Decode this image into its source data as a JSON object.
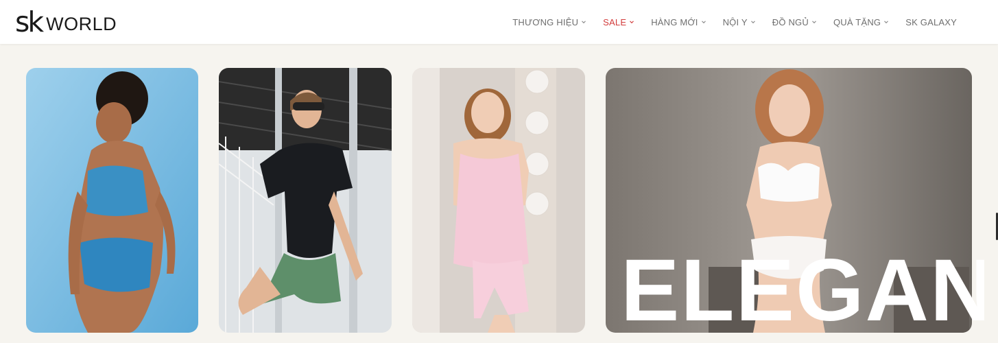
{
  "brand": {
    "mark": "sk",
    "word": "WORLD"
  },
  "nav": {
    "items": [
      {
        "label": "THƯƠNG HIỆU",
        "has_dropdown": true
      },
      {
        "label": "SALE",
        "has_dropdown": true,
        "highlight_color": "#d23c3c"
      },
      {
        "label": "HÀNG MỚI",
        "has_dropdown": true
      },
      {
        "label": "NỘI Y",
        "has_dropdown": true
      },
      {
        "label": "ĐỒ NGỦ",
        "has_dropdown": true
      },
      {
        "label": "QUÀ TẶNG",
        "has_dropdown": true
      },
      {
        "label": "SK GALAXY",
        "has_dropdown": false
      }
    ]
  },
  "banners": [
    {
      "subject": "model in blue swimwear on light blue background"
    },
    {
      "subject": "model in black t-shirt and green shorts, sportswear"
    },
    {
      "subject": "model in pink pajama set by vanity mirror"
    },
    {
      "subject": "model in white lingerie set on grey background"
    }
  ],
  "hero_overlay": {
    "text": "ELEGANT"
  },
  "colors": {
    "header_bg": "#ffffff",
    "page_bg": "#f6f4ef",
    "nav_text": "#6e6e6e",
    "sale_accent": "#d23c3c",
    "overlay_text": "#ffffff"
  }
}
